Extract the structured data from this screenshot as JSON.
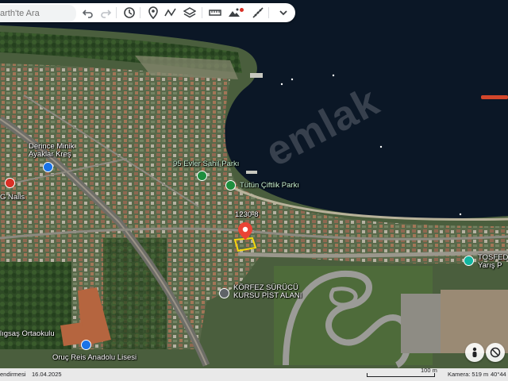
{
  "search": {
    "placeholder": "arth'te Ara"
  },
  "toolbar": {
    "icons": [
      "undo-icon",
      "redo-icon",
      "history-icon",
      "placemark-icon",
      "path-icon",
      "layers-icon",
      "ruler-icon",
      "image-overlay-icon",
      "measure-icon",
      "chevron-down-icon"
    ]
  },
  "map_labels": {
    "derince_line1": "Derince Minik",
    "derince_line2": "Ayaklar Kreş",
    "g_nails": "G Nails",
    "evler_sahil": "95 Evler Sahil Parkı",
    "tutun": "Tütün Çiftlik Parkı",
    "parcel": "1230-8",
    "korfez_line1": "KÖRFEZ SÜRÜCÜ",
    "korfez_line2": "KURSU PİST ALANI",
    "tosfed_line1": "TOSFED",
    "tosfed_line2": "Yarış P",
    "ortaokulu": "lıgsaş Ortaokulu",
    "lisesi": "Oruç Reis Anadolu Lisesi"
  },
  "watermark": "emlak",
  "bottom": {
    "left": "endirmesi",
    "date": "16.04.2025",
    "scale": "100 m",
    "camera": "Kamera: 519 m",
    "coord": "40°44"
  },
  "colors": {
    "water": "#0b1726",
    "land": "#3f5a35",
    "accent": "#1a73e8",
    "poi_green": "#1e8e3e",
    "pin": "#ea4335"
  }
}
